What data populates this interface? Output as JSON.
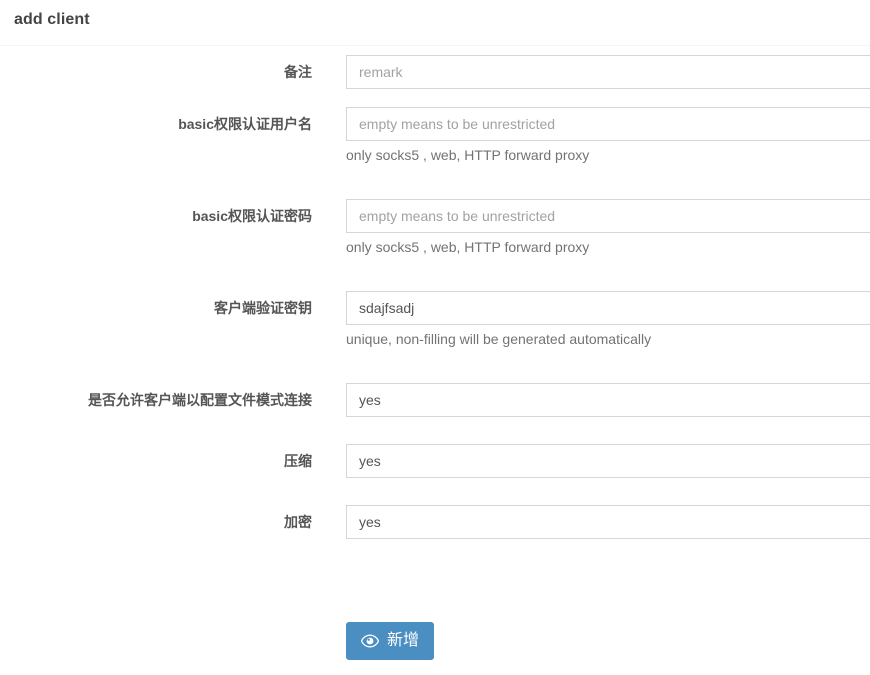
{
  "header": {
    "title": "add client"
  },
  "form": {
    "fields": [
      {
        "label": "备注",
        "control": "input",
        "value": "",
        "placeholder": "remark",
        "help": ""
      },
      {
        "label": "basic权限认证用户名",
        "control": "input",
        "value": "",
        "placeholder": "empty means to be unrestricted",
        "help": "only socks5 , web, HTTP forward proxy"
      },
      {
        "label": "basic权限认证密码",
        "control": "input",
        "value": "",
        "placeholder": "empty means to be unrestricted",
        "help": "only socks5 , web, HTTP forward proxy"
      },
      {
        "label": "客户端验证密钥",
        "control": "input",
        "value": "sdajfsadj",
        "placeholder": "",
        "help": "unique, non-filling will be generated automatically"
      },
      {
        "label": "是否允许客户端以配置文件模式连接",
        "control": "select",
        "value": "yes",
        "placeholder": "",
        "help": ""
      },
      {
        "label": "压缩",
        "control": "select",
        "value": "yes",
        "placeholder": "",
        "help": ""
      },
      {
        "label": "加密",
        "control": "select",
        "value": "yes",
        "placeholder": "",
        "help": ""
      }
    ],
    "submit": {
      "label": "新增",
      "icon": "eye-icon",
      "color": "#4a8ec2"
    }
  }
}
